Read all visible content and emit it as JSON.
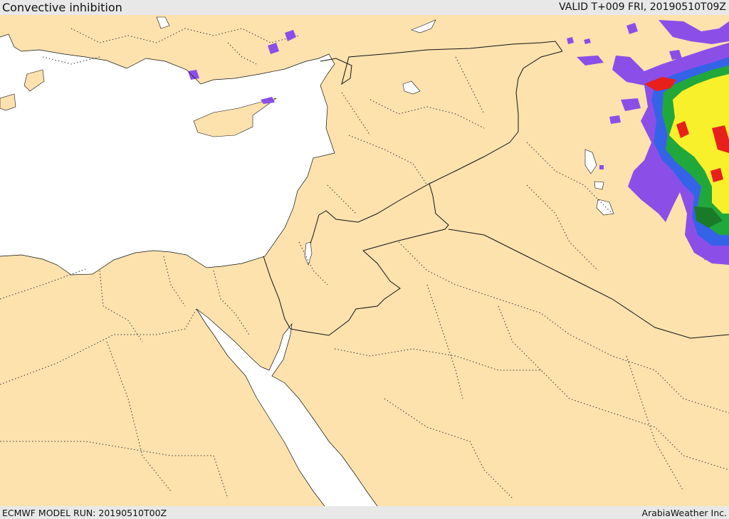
{
  "header": {
    "title": "Convective inhibition",
    "valid_time": "VALID T+009 FRI, 20190510T09Z"
  },
  "footer": {
    "model_run": "ECMWF MODEL RUN: 20190510T00Z",
    "credit": "ArabiaWeather Inc."
  },
  "colors": {
    "land": "#fde2ae",
    "water": "#ffffff",
    "border": "#111111",
    "purple": "#8b4fe8",
    "blue": "#3563e8",
    "green": "#21a83a",
    "dark_green": "#1a7a2a",
    "yellow": "#f8f02a",
    "red": "#e8201c"
  }
}
